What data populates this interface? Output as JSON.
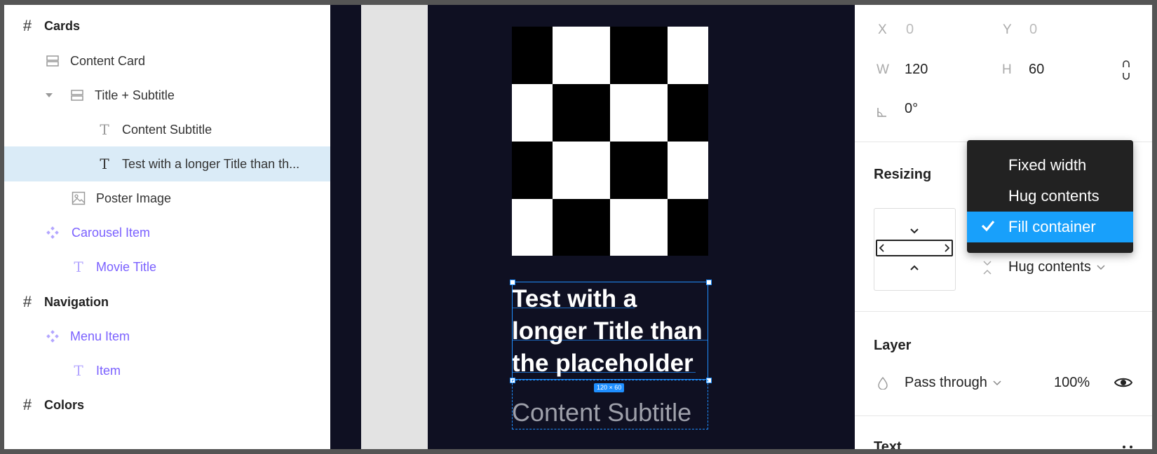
{
  "layers": {
    "items": [
      {
        "label": "Cards",
        "icon": "frame-icon",
        "style": "bold"
      },
      {
        "label": "Content Card",
        "icon": "auto-layout-icon",
        "style": "normal"
      },
      {
        "label": "Title + Subtitle",
        "icon": "auto-layout-icon",
        "style": "normal",
        "expanded": true
      },
      {
        "label": "Content Subtitle",
        "icon": "text-icon",
        "style": "normal"
      },
      {
        "label": "Test with a longer Title than th...",
        "icon": "text-icon",
        "style": "normal",
        "selected": true
      },
      {
        "label": "Poster Image",
        "icon": "image-icon",
        "style": "normal"
      },
      {
        "label": "Carousel Item",
        "icon": "component-icon",
        "style": "purple"
      },
      {
        "label": "Movie Title",
        "icon": "text-icon",
        "style": "purple"
      },
      {
        "label": "Navigation",
        "icon": "frame-icon",
        "style": "bold"
      },
      {
        "label": "Menu Item",
        "icon": "component-icon",
        "style": "purple"
      },
      {
        "label": "Item",
        "icon": "text-icon",
        "style": "purple"
      },
      {
        "label": "Colors",
        "icon": "frame-icon",
        "style": "bold"
      }
    ]
  },
  "canvas": {
    "title_lines": [
      "Test with a",
      "longer Title than",
      "the placeholder"
    ],
    "dimension_badge": "120 × 60",
    "subtitle": "Content Subtitle"
  },
  "properties": {
    "x_label": "X",
    "x_value": "0",
    "y_label": "Y",
    "y_value": "0",
    "w_label": "W",
    "w_value": "120",
    "h_label": "H",
    "h_value": "60",
    "rotation": "0°",
    "resizing": {
      "title": "Resizing",
      "vertical_value": "Hug contents",
      "dropdown_options": [
        {
          "label": "Fixed width",
          "selected": false
        },
        {
          "label": "Hug contents",
          "selected": false
        },
        {
          "label": "Fill container",
          "selected": true
        }
      ]
    },
    "layer": {
      "title": "Layer",
      "blend_mode": "Pass through",
      "opacity": "100%"
    },
    "text": {
      "title": "Text"
    }
  },
  "colors": {
    "accent": "#18a0fb",
    "selection": "#daebf7",
    "component": "#7b61ff",
    "canvas": "#0f1022"
  }
}
